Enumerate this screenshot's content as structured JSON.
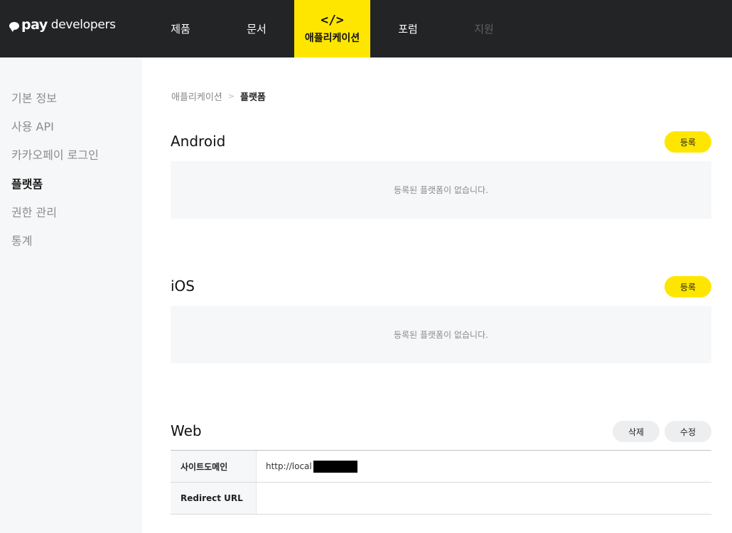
{
  "header": {
    "logo": {
      "brand": "pay",
      "suffix": "developers"
    },
    "nav": [
      {
        "label": "제품",
        "state": "normal"
      },
      {
        "label": "문서",
        "state": "normal"
      },
      {
        "label": "애플리케이션",
        "state": "active",
        "icon": "code-icon"
      },
      {
        "label": "포럼",
        "state": "normal"
      },
      {
        "label": "지원",
        "state": "disabled"
      }
    ],
    "nav_icon_glyph": "</>"
  },
  "sidebar": {
    "items": [
      {
        "label": "기본 정보"
      },
      {
        "label": "사용 API"
      },
      {
        "label": "카카오페이 로그인"
      },
      {
        "label": "플랫폼",
        "active": true
      },
      {
        "label": "권한 관리"
      },
      {
        "label": "통계"
      }
    ]
  },
  "breadcrumb": {
    "parent": "애플리케이션",
    "current": "플랫폼"
  },
  "sections": {
    "android": {
      "title": "Android",
      "button": "등록",
      "empty": "등록된 플랫폼이 없습니다."
    },
    "ios": {
      "title": "iOS",
      "button": "등록",
      "empty": "등록된 플랫폼이 없습니다."
    },
    "web": {
      "title": "Web",
      "delete_button": "삭제",
      "edit_button": "수정",
      "rows": [
        {
          "label": "사이트도메인",
          "value": "http://local"
        },
        {
          "label": "Redirect URL",
          "value": ""
        }
      ]
    }
  },
  "colors": {
    "accent": "#ffe600",
    "header_bg": "#222426",
    "sidebar_bg": "#f6f7f8"
  }
}
